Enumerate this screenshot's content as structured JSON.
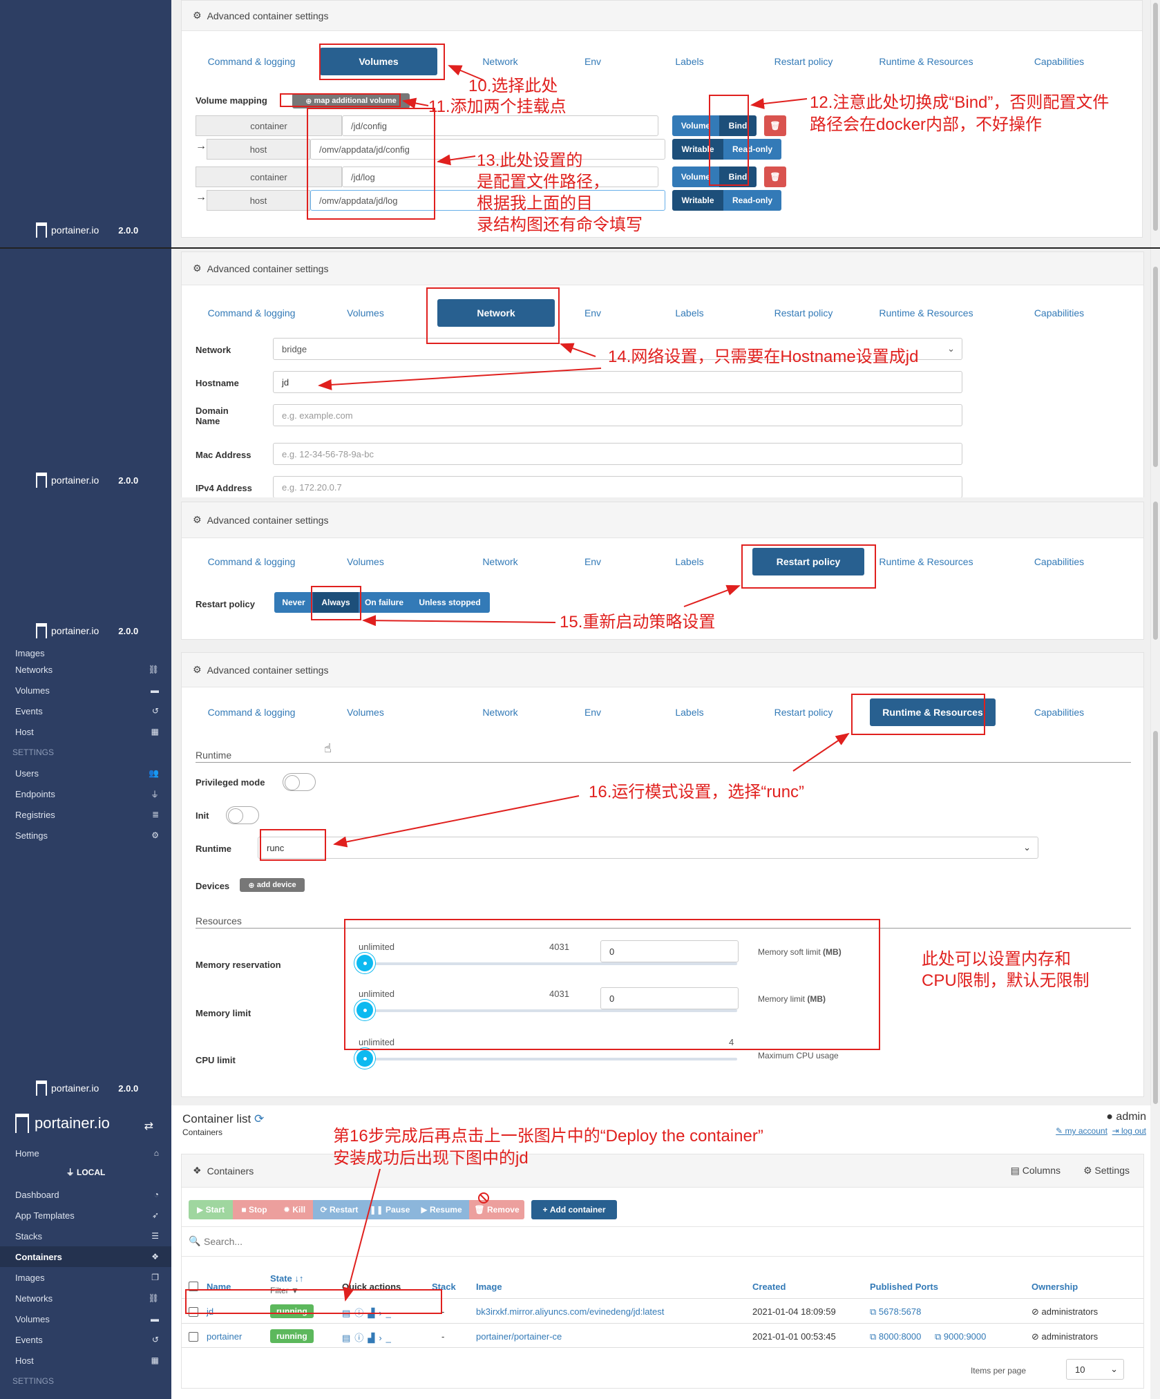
{
  "brand": {
    "name": "portainer.io",
    "version": "2.0.0"
  },
  "section_title": "Advanced container settings",
  "tabs": [
    "Command & logging",
    "Volumes",
    "Network",
    "Env",
    "Labels",
    "Restart policy",
    "Runtime & Resources",
    "Capabilities"
  ],
  "volumes": {
    "mapping_label": "Volume mapping",
    "add_button": "map additional volume",
    "container_addon": "container",
    "host_addon": "host",
    "rows": [
      {
        "container": "/jd/config",
        "host": "/omv/appdata/jd/config"
      },
      {
        "container": "/jd/log",
        "host": "/omv/appdata/jd/log"
      }
    ],
    "type_buttons": [
      "Volume",
      "Bind"
    ],
    "mode_buttons": [
      "Writable",
      "Read-only"
    ],
    "arrow_glyph": "→"
  },
  "network": {
    "network_label": "Network",
    "network_value": "bridge",
    "hostname_label": "Hostname",
    "hostname_value": "jd",
    "domain_label": "Domain Name",
    "domain_placeholder": "e.g. example.com",
    "mac_label": "Mac Address",
    "mac_placeholder": "e.g. 12-34-56-78-9a-bc",
    "ipv4_label": "IPv4 Address",
    "ipv4_placeholder": "e.g. 172.20.0.7"
  },
  "restart": {
    "label": "Restart policy",
    "options": [
      "Never",
      "Always",
      "On failure",
      "Unless stopped"
    ],
    "selected": "Always"
  },
  "runtime": {
    "runtime_heading": "Runtime",
    "privileged_label": "Privileged mode",
    "init_label": "Init",
    "runtime_label": "Runtime",
    "runtime_value": "runc",
    "devices_label": "Devices",
    "add_device": "add device",
    "resources_heading": "Resources",
    "memory_reservation_label": "Memory reservation",
    "memory_limit_label": "Memory limit",
    "cpu_limit_label": "CPU limit",
    "slider_min": "unlimited",
    "mem_max": "4031",
    "cpu_max": "4",
    "mem_res_value": "0",
    "mem_limit_value": "0",
    "mem_soft_label": "Memory soft limit",
    "mem_limit_hint": "Memory limit",
    "mb_unit": "(MB)",
    "cpu_usage_label": "Maximum CPU usage",
    "mem_res_fraction": 0,
    "mem_limit_fraction": 0,
    "cpu_fraction": 0
  },
  "sidebar_partial": [
    "Images",
    "Networks",
    "Volumes",
    "Events",
    "Host"
  ],
  "sidebar_settings_section": "SETTINGS",
  "sidebar_settings": [
    "Users",
    "Endpoints",
    "Registries",
    "Settings"
  ],
  "container_list": {
    "title": "Container list",
    "breadcrumb": "Containers",
    "user": "admin",
    "my_account": "my account",
    "log_out": "log out",
    "endpoint": "LOCAL",
    "sidebar": [
      "Home",
      "Dashboard",
      "App Templates",
      "Stacks",
      "Containers",
      "Images",
      "Networks",
      "Volumes",
      "Events",
      "Host"
    ],
    "settings_section": "SETTINGS",
    "panel_title": "Containers",
    "columns_btn": "Columns",
    "settings_btn": "Settings",
    "actions": [
      "Start",
      "Stop",
      "Kill",
      "Restart",
      "Pause",
      "Resume",
      "Remove"
    ],
    "add_container": "Add container",
    "search_placeholder": "Search...",
    "headers": [
      "Name",
      "State",
      "Quick actions",
      "Stack",
      "Image",
      "Created",
      "Published Ports",
      "Ownership"
    ],
    "state_filter": "Filter",
    "rows": [
      {
        "name": "jd",
        "state": "running",
        "stack": "-",
        "image": "bk3irxkf.mirror.aliyuncs.com/evinedeng/jd:latest",
        "created": "2021-01-04 18:09:59",
        "ports": [
          "5678:5678"
        ],
        "ownership": "administrators"
      },
      {
        "name": "portainer",
        "state": "running",
        "stack": "-",
        "image": "portainer/portainer-ce",
        "created": "2021-01-01 00:53:45",
        "ports": [
          "8000:8000",
          "9000:9000"
        ],
        "ownership": "administrators"
      }
    ],
    "items_per_page_label": "Items per page",
    "items_per_page": "10"
  },
  "notes": {
    "n10": "10.选择此处",
    "n11": "11.添加两个挂载点",
    "n12a": "12.注意此处切换成“Bind”，否则配置文件",
    "n12b": "路径会在docker内部，不好操作",
    "n13a": "13.此处设置的",
    "n13b": "是配置文件路径，",
    "n13c": "根据我上面的目",
    "n13d": "录结构图还有命令填写",
    "n14": "14.网络设置，只需要在Hostname设置成jd",
    "n15": "15.重新启动策略设置",
    "n16": "16.运行模式设置，选择“runc”",
    "nres_a": "此处可以设置内存和",
    "nres_b": "CPU限制，默认无限制",
    "n_final_a": "第16步完成后再点击上一张图片中的“Deploy the container”",
    "n_final_b": "安装成功后出现下图中的jd"
  },
  "colors": {
    "accent": "#337ab7",
    "active_tab": "#286090",
    "sidebar": "#2d3e63",
    "annotation": "#e0201e",
    "running": "#5cb85c"
  }
}
